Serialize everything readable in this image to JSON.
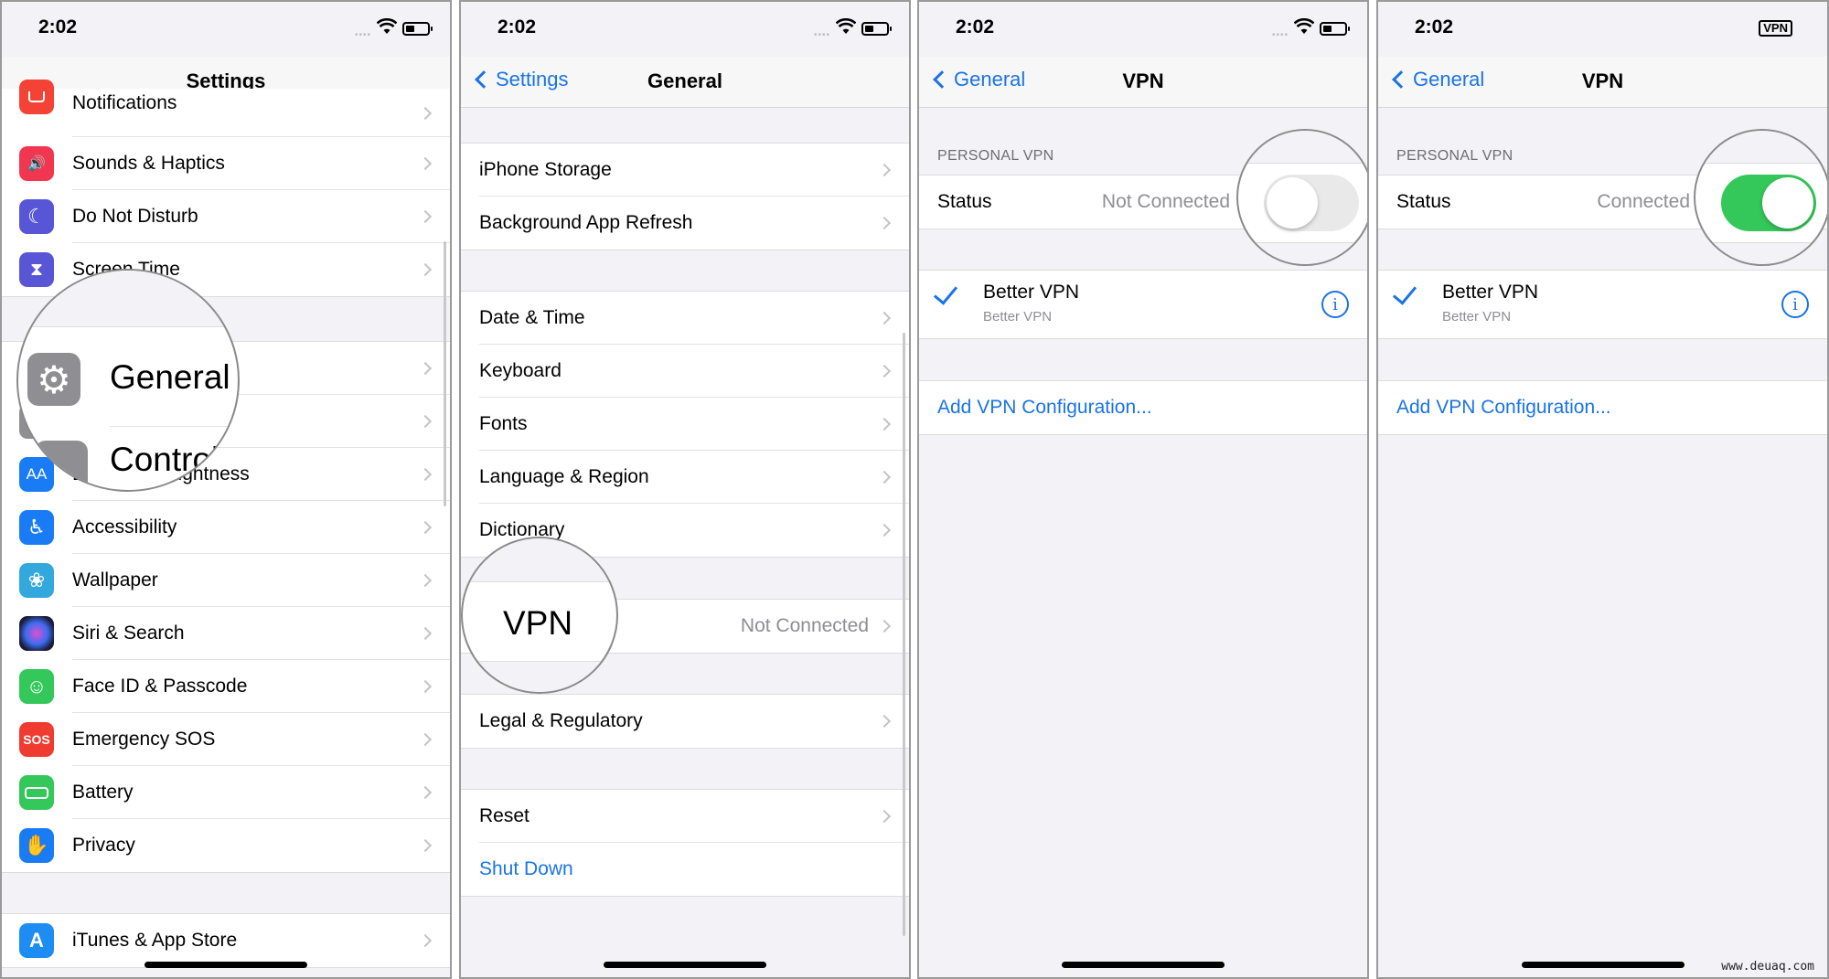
{
  "panels": [
    {
      "status_time": "2:02",
      "nav_title": "Settings",
      "list_items": [
        {
          "label": "Notifications",
          "icon": "notifications-icon",
          "color": "#f44336"
        },
        {
          "label": "Sounds & Haptics",
          "icon": "speaker-icon",
          "color": "#f0374f"
        },
        {
          "label": "Do Not Disturb",
          "icon": "moon-icon",
          "color": "#5856d6"
        },
        {
          "label": "Screen Time",
          "icon": "hourglass-icon",
          "color": "#5856d6"
        },
        {
          "label": "General",
          "icon": "gear-icon",
          "color": "#8e8e93"
        },
        {
          "label": "Control Centre",
          "icon": "switches-icon",
          "color": "#8e8e93"
        },
        {
          "label": "Display & Brightness",
          "icon": "text-size-icon",
          "color": "#1a7cf5"
        },
        {
          "label": "Accessibility",
          "icon": "accessibility-icon",
          "color": "#1a7cf5"
        },
        {
          "label": "Wallpaper",
          "icon": "flower-icon",
          "color": "#33a8dd"
        },
        {
          "label": "Siri & Search",
          "icon": "siri-icon",
          "color": "#222244"
        },
        {
          "label": "Face ID & Passcode",
          "icon": "face-id-icon",
          "color": "#34c759"
        },
        {
          "label": "Emergency SOS",
          "icon": "sos-icon",
          "color": "#ef3b30",
          "glyph": "SOS"
        },
        {
          "label": "Battery",
          "icon": "battery-icon",
          "color": "#34c759"
        },
        {
          "label": "Privacy",
          "icon": "hand-icon",
          "color": "#1a7cf5"
        },
        {
          "label": "iTunes & App Store",
          "icon": "app-store-icon",
          "color": "#1d8cf3"
        }
      ],
      "magnified": {
        "primary": "General",
        "secondary": "Control"
      },
      "icon_glyph_aa": "AA"
    },
    {
      "status_time": "2:02",
      "back_label": "Settings",
      "nav_title": "General",
      "groups": [
        [
          "iPhone Storage",
          "Background App Refresh"
        ],
        [
          "Date & Time",
          "Keyboard",
          "Fonts",
          "Language & Region",
          "Dictionary"
        ],
        [
          "VPN"
        ],
        [
          "Legal & Regulatory"
        ],
        [
          "Reset",
          "Shut Down"
        ]
      ],
      "vpn_value": "Not Connected",
      "magnified": "VPN"
    },
    {
      "status_time": "2:02",
      "back_label": "General",
      "nav_title": "VPN",
      "section_header": "PERSONAL VPN",
      "status_label": "Status",
      "status_value": "Not Connected",
      "toggle_on": false,
      "vpn_name": "Better VPN",
      "vpn_sub": "Better VPN",
      "add_config": "Add VPN Configuration..."
    },
    {
      "status_time": "2:02",
      "status_badge": "VPN",
      "back_label": "General",
      "nav_title": "VPN",
      "section_header": "PERSONAL VPN",
      "status_label": "Status",
      "status_value": "Connected",
      "toggle_on": true,
      "vpn_name": "Better VPN",
      "vpn_sub": "Better VPN",
      "add_config": "Add VPN Configuration..."
    }
  ],
  "colors": {
    "accent": "#1a73e8",
    "toggle_on": "#34c759",
    "toggle_off": "#e9e9ea"
  },
  "watermark": "www.deuaq.com"
}
